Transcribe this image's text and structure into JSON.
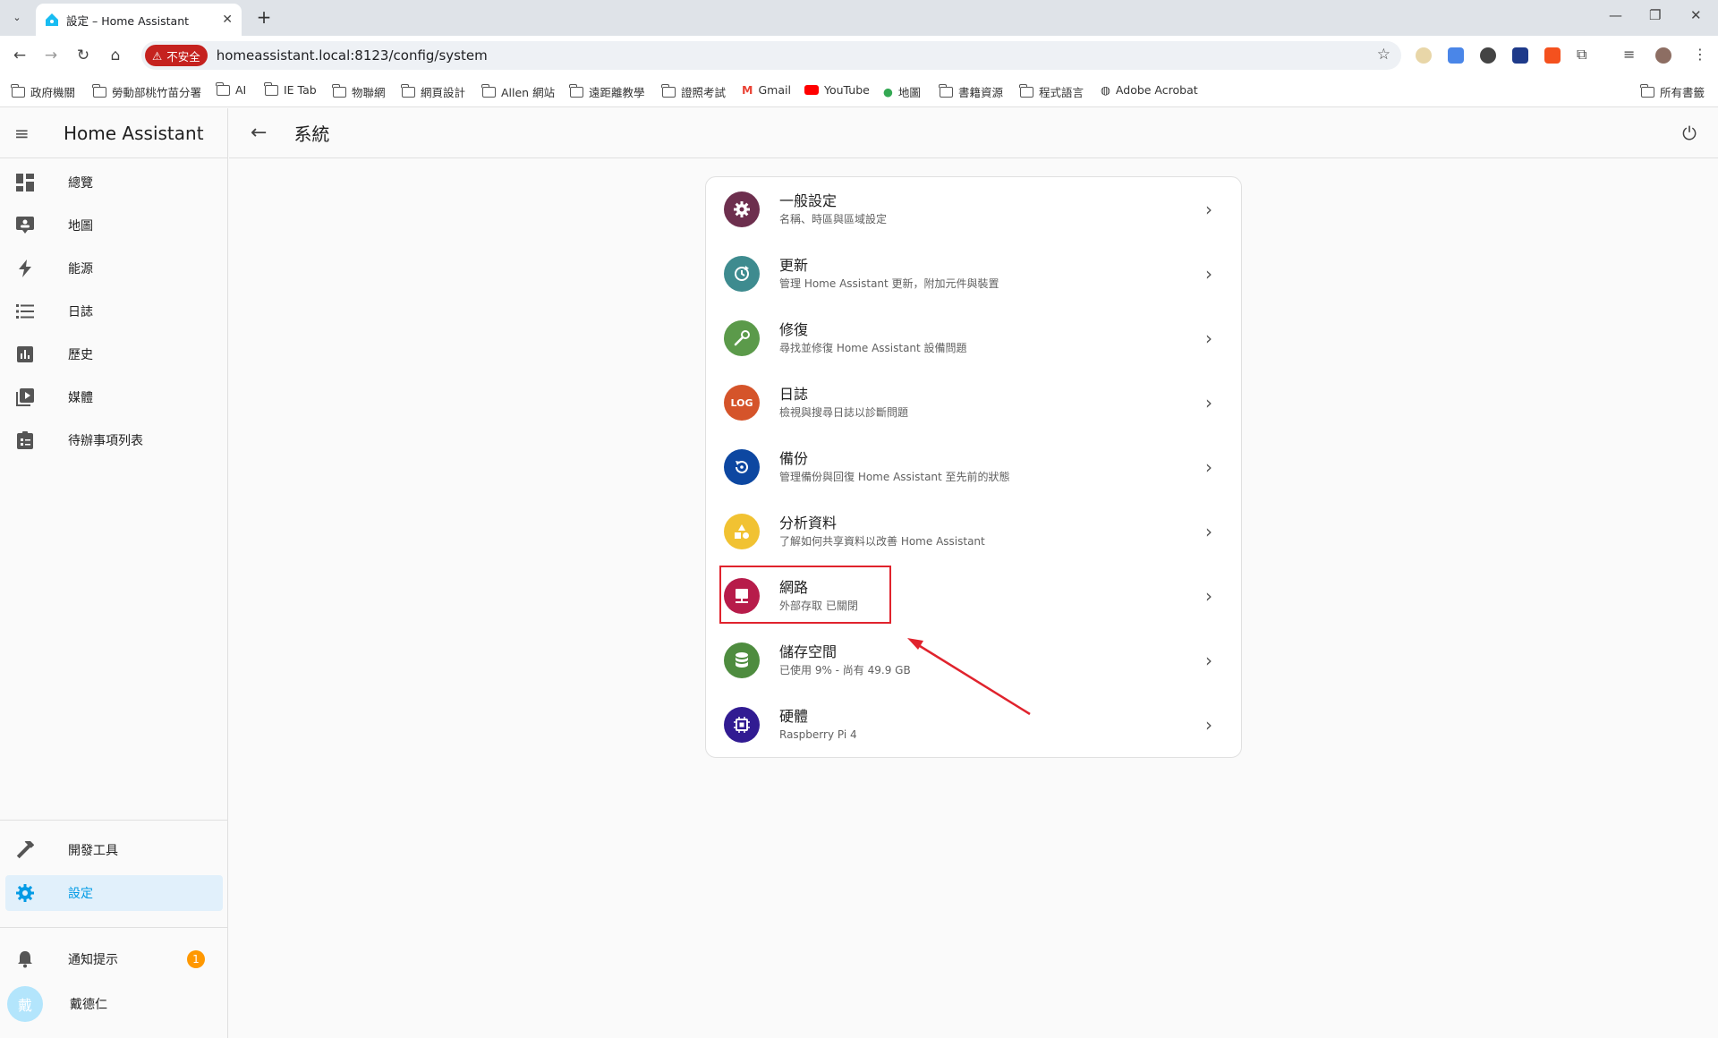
{
  "browser": {
    "tab_title": "設定 – Home Assistant",
    "new_tab": "+",
    "insecure_label": "不安全",
    "url": "homeassistant.local:8123/config/system",
    "bookmarks": [
      "政府機關",
      "勞動部桃竹苗分署",
      "AI",
      "IE Tab",
      "物聯網",
      "網頁設計",
      "Allen 網站",
      "遠距離教學",
      "證照考試",
      "Gmail",
      "YouTube",
      "地圖",
      "書籍資源",
      "程式語言",
      "Adobe Acrobat"
    ],
    "all_bookmarks": "所有書籤"
  },
  "sidebar": {
    "title": "Home Assistant",
    "items": [
      {
        "label": "總覽",
        "icon": "dashboard-icon"
      },
      {
        "label": "地圖",
        "icon": "map-icon"
      },
      {
        "label": "能源",
        "icon": "lightning-icon"
      },
      {
        "label": "日誌",
        "icon": "list-icon"
      },
      {
        "label": "歷史",
        "icon": "chart-icon"
      },
      {
        "label": "媒體",
        "icon": "media-icon"
      },
      {
        "label": "待辦事項列表",
        "icon": "clipboard-icon"
      }
    ],
    "dev_tools": "開發工具",
    "settings": "設定",
    "notifications": "通知提示",
    "notifications_count": "1",
    "user_name": "戴德仁",
    "user_initial": "戴"
  },
  "header": {
    "title": "系統"
  },
  "system_items": [
    {
      "name": "一般設定",
      "desc": "名稱、時區與區域設定",
      "color": "#6d2f4e",
      "icon": "gear-icon"
    },
    {
      "name": "更新",
      "desc": "管理 Home Assistant 更新，附加元件與裝置",
      "color": "#3e8b8f",
      "icon": "update-icon"
    },
    {
      "name": "修復",
      "desc": "尋找並修復 Home Assistant 設備問題",
      "color": "#5b9a4a",
      "icon": "wrench-icon"
    },
    {
      "name": "日誌",
      "desc": "檢視與搜尋日誌以診斷問題",
      "color": "#d5542a",
      "icon": "log-icon",
      "icon_text": "LOG"
    },
    {
      "name": "備份",
      "desc": "管理備份與回復 Home Assistant 至先前的狀態",
      "color": "#0d47a1",
      "icon": "backup-icon"
    },
    {
      "name": "分析資料",
      "desc": "了解如何共享資料以改善 Home Assistant",
      "color": "#f1c232",
      "icon": "shapes-icon"
    },
    {
      "name": "網路",
      "desc": "外部存取 已關閉",
      "color": "#b71c4a",
      "icon": "network-icon"
    },
    {
      "name": "儲存空間",
      "desc": "已使用 9% - 尚有 49.9 GB",
      "color": "#4e8c3f",
      "icon": "database-icon"
    },
    {
      "name": "硬體",
      "desc": "Raspberry Pi 4",
      "color": "#311b92",
      "icon": "chip-icon"
    }
  ]
}
